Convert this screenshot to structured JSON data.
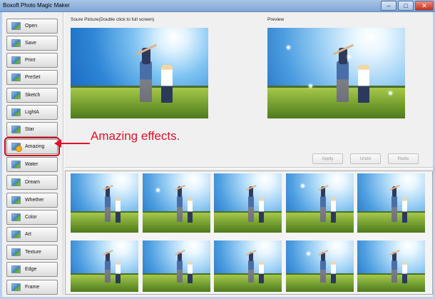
{
  "window": {
    "title": "Boxoft Photo Magic Maker",
    "controls": {
      "minimize": "–",
      "maximize": "□",
      "close": "✕"
    }
  },
  "sidebar": {
    "items": [
      {
        "label": "Open",
        "icon": "open-icon"
      },
      {
        "label": "Save",
        "icon": "save-icon"
      },
      {
        "label": "Print",
        "icon": "print-icon"
      },
      {
        "label": "PreSet",
        "icon": "preset-icon"
      },
      {
        "label": "Sketch",
        "icon": "sketch-icon"
      },
      {
        "label": "LightA",
        "icon": "lighta-icon"
      },
      {
        "label": "Star",
        "icon": "star-icon"
      },
      {
        "label": "Amazing",
        "icon": "amazing-icon",
        "selected": true
      },
      {
        "label": "Water",
        "icon": "water-icon"
      },
      {
        "label": "Dream",
        "icon": "dream-icon"
      },
      {
        "label": "Whether",
        "icon": "whether-icon"
      },
      {
        "label": "Color",
        "icon": "color-icon"
      },
      {
        "label": "Art",
        "icon": "art-icon"
      },
      {
        "label": "Texture",
        "icon": "texture-icon"
      },
      {
        "label": "Edge",
        "icon": "edge-icon"
      },
      {
        "label": "Frame",
        "icon": "frame-icon"
      }
    ]
  },
  "source": {
    "label": "Soure Picture(Double click to full screen)"
  },
  "preview": {
    "label": "Preview"
  },
  "actions": {
    "apply": "Apply",
    "undo": "Undo",
    "redo": "Redo"
  },
  "thumbnails": {
    "rows": 2,
    "columns": 5,
    "count": 10
  },
  "annotation": {
    "text": "Amazing effects.",
    "color": "#e0102a"
  },
  "colors": {
    "accent_red": "#d0021b",
    "titlebar": "#7fa6d6"
  }
}
